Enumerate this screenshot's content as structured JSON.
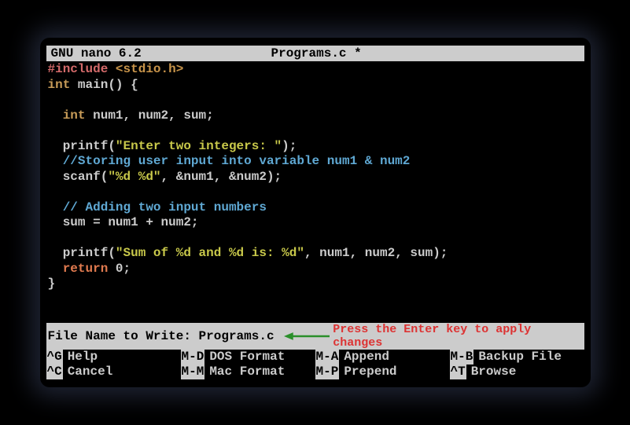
{
  "title": {
    "app": " GNU nano 6.2",
    "file": "Programs.c *"
  },
  "code": {
    "l1a": "#include",
    "l1b": "<stdio.h>",
    "l2a": "int",
    "l2b": " main() {",
    "l3": "",
    "l4a": "  int",
    "l4b": " num1, num2, sum;",
    "l5": "",
    "l6a": "  printf(",
    "l6b": "\"Enter two integers: \"",
    "l6c": ");",
    "l7": "  //Storing user input into variable num1 & num2",
    "l8a": "  scanf(",
    "l8b": "\"%d %d\"",
    "l8c": ", &num1, &num2);",
    "l9": "",
    "l10": "  // Adding two input numbers",
    "l11": "  sum = num1 + num2;",
    "l12": "",
    "l13a": "  printf(",
    "l13b": "\"Sum of %d and %d is: %d\"",
    "l13c": ", num1, num2, sum);",
    "l14a": "  return",
    "l14b": " 0;",
    "l15": "}"
  },
  "prompt": {
    "label": "File Name to Write: Programs.c",
    "hint": "Press the Enter key to apply changes"
  },
  "shortcuts": {
    "row1": [
      {
        "key": "^G",
        "label": "Help"
      },
      {
        "key": "M-D",
        "label": "DOS Format"
      },
      {
        "key": "M-A",
        "label": "Append"
      },
      {
        "key": "M-B",
        "label": "Backup File"
      }
    ],
    "row2": [
      {
        "key": "^C",
        "label": "Cancel"
      },
      {
        "key": "M-M",
        "label": "Mac Format"
      },
      {
        "key": "M-P",
        "label": "Prepend"
      },
      {
        "key": "^T",
        "label": "Browse"
      }
    ]
  }
}
